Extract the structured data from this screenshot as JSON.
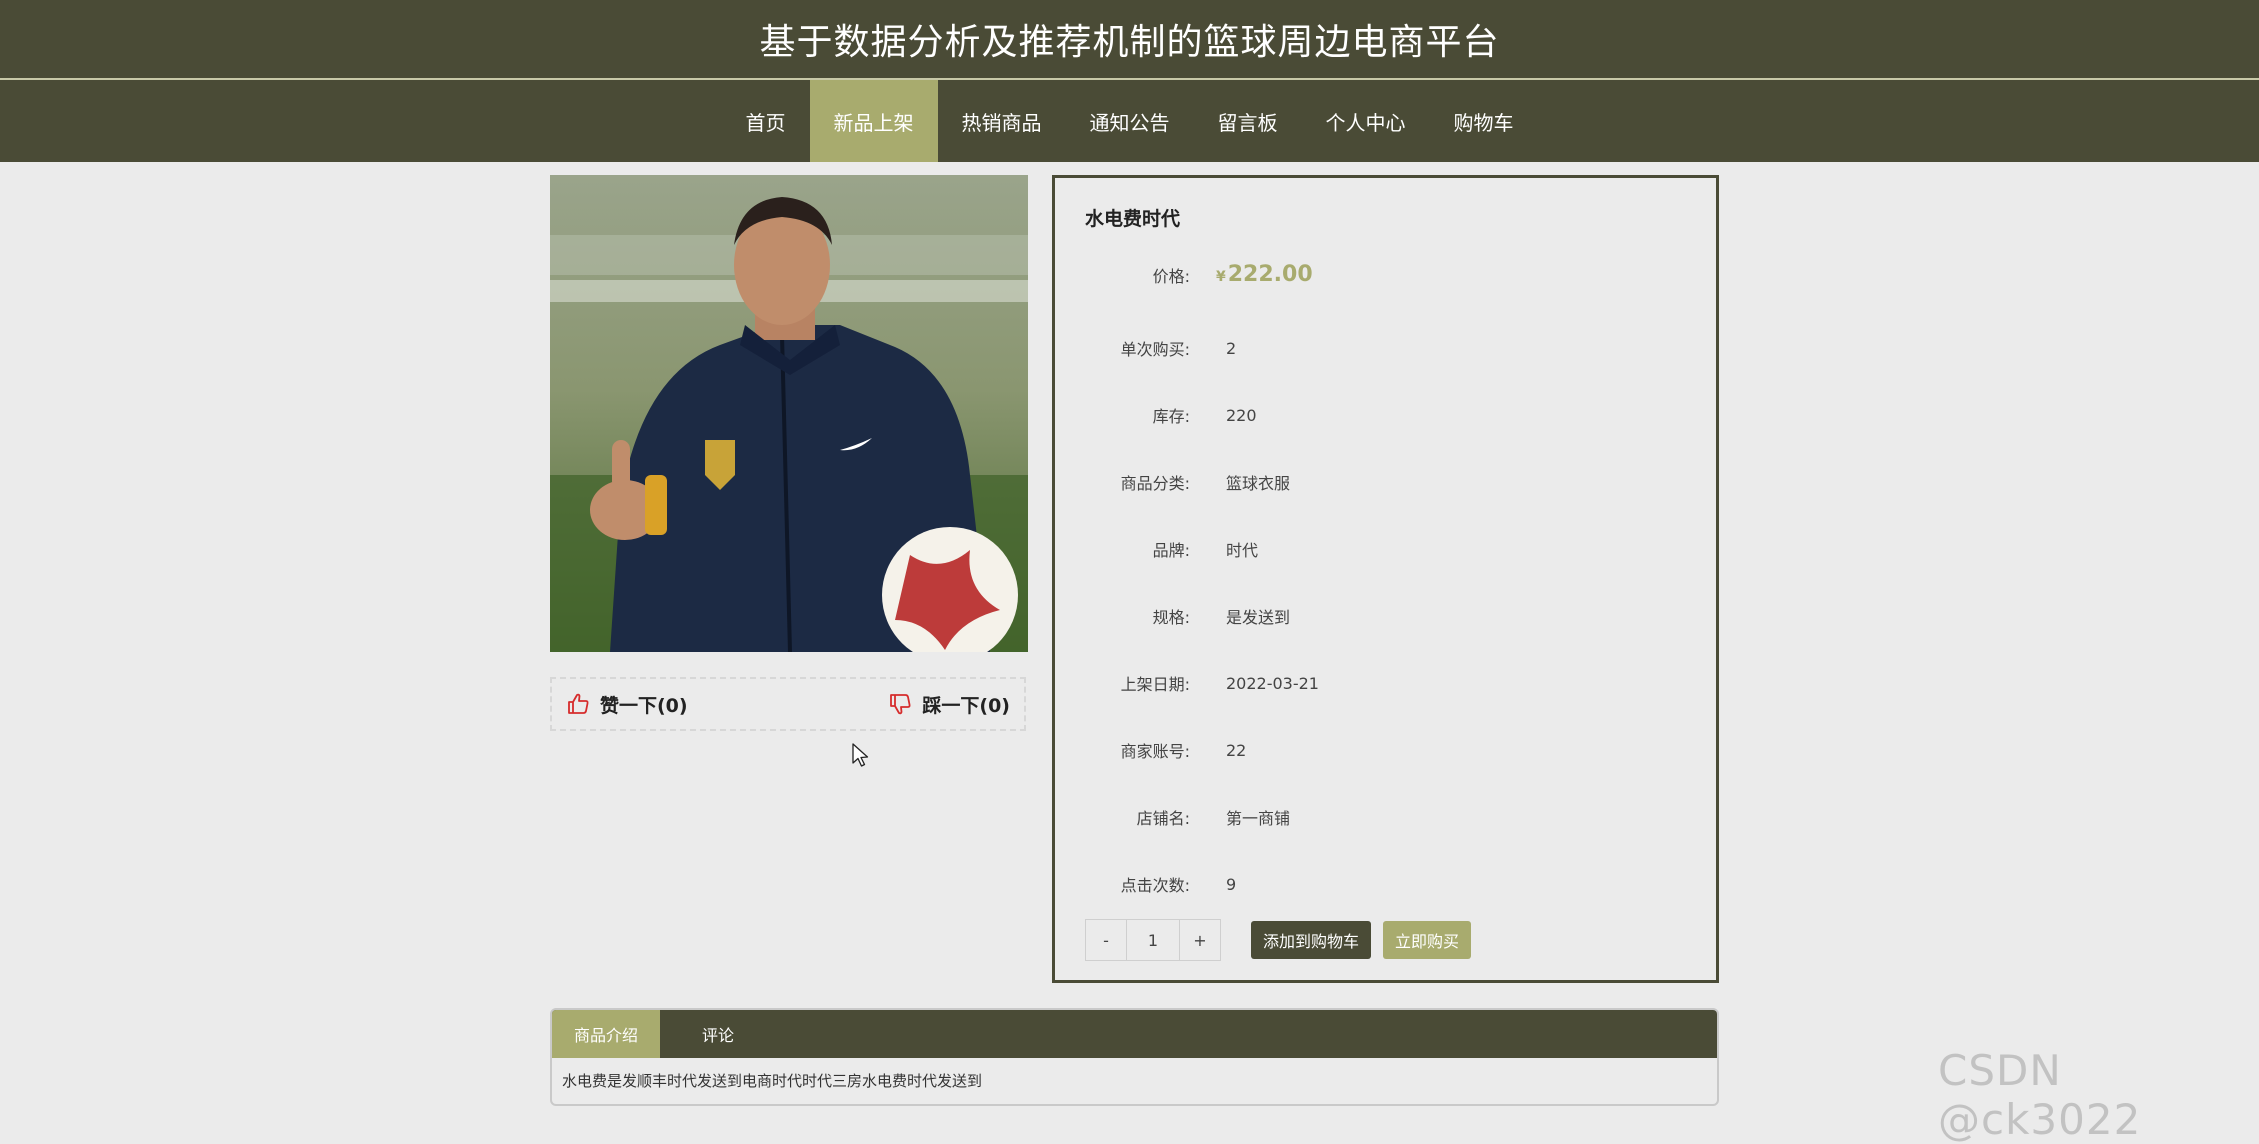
{
  "site": {
    "title": "基于数据分析及推荐机制的篮球周边电商平台"
  },
  "nav": {
    "items": [
      {
        "label": "首页"
      },
      {
        "label": "新品上架"
      },
      {
        "label": "热销商品"
      },
      {
        "label": "通知公告"
      },
      {
        "label": "留言板"
      },
      {
        "label": "个人中心"
      },
      {
        "label": "购物车"
      }
    ],
    "active_index": 1
  },
  "votes": {
    "like_label": "赞一下(0)",
    "dislike_label": "踩一下(0)"
  },
  "product": {
    "name": "水电费时代",
    "price_label": "价格:",
    "currency": "¥",
    "price": "222.00",
    "fields": [
      {
        "label": "单次购买:",
        "value": "2"
      },
      {
        "label": "库存:",
        "value": "220"
      },
      {
        "label": "商品分类:",
        "value": "篮球衣服"
      },
      {
        "label": "品牌:",
        "value": "时代"
      },
      {
        "label": "规格:",
        "value": "是发送到"
      },
      {
        "label": "上架日期:",
        "value": "2022-03-21"
      },
      {
        "label": "商家账号:",
        "value": "22"
      },
      {
        "label": "店铺名:",
        "value": "第一商铺"
      },
      {
        "label": "点击次数:",
        "value": "9"
      }
    ]
  },
  "actions": {
    "minus": "-",
    "quantity": "1",
    "plus": "+",
    "add_to_cart": "添加到购物车",
    "buy_now": "立即购买"
  },
  "tabs": {
    "items": [
      {
        "label": "商品介绍"
      },
      {
        "label": "评论"
      }
    ],
    "content": "水电费是发顺丰时代发送到电商时代时代三房水电费时代发送到"
  },
  "watermark": "CSDN @ck3022",
  "colors": {
    "header_bg": "#4a4b36",
    "accent": "#a8ab6e",
    "page_bg": "#ebebeb",
    "vote_icon": "#d62c2c"
  }
}
